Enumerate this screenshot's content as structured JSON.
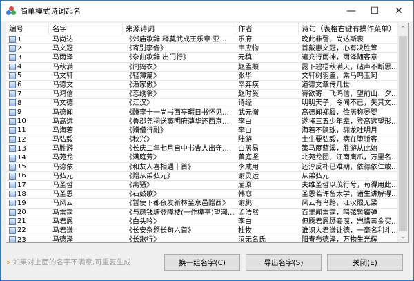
{
  "window": {
    "title": "简单模式诗词起名"
  },
  "table": {
    "headers": [
      "编号",
      "名字",
      "来源诗词",
      "作者",
      "诗句（表格右键有操作菜单）"
    ],
    "rows": [
      [
        "1",
        "马尚达",
        "《郊庙歌辞·释奠武成王乐章·亚…",
        "乐府",
        "晚此非謦，尚达斯衷"
      ],
      [
        "2",
        "马文冠",
        "《寄别李儋》",
        "韦应物",
        "首戴惠文冠，心有决胜筹"
      ],
      [
        "3",
        "马雨泽",
        "《杂曲歌辞·出门行》",
        "元稹",
        "遣充行雨神，雨泽随客意"
      ],
      [
        "4",
        "马秋满",
        "《闻捣衣》",
        "赵孟頫",
        "露下碧梧秋满天，砧声不断思…"
      ],
      [
        "5",
        "马文轩",
        "《轻薄篇》",
        "张华",
        "文轩树羽盖，乘马鸣玉珂"
      ],
      [
        "6",
        "马德文",
        "《渔家傲》",
        "辛弃疾",
        "道德文章传几世"
      ],
      [
        "7",
        "马鸿信",
        "《恋绣衾》",
        "赵时奚",
        "待欲寄、飞鸿信，望前山、夕…"
      ],
      [
        "8",
        "马文德",
        "《江汉》",
        "诗经",
        "明明天子，令闻不已，矢其文…"
      ],
      [
        "9",
        "马德闻",
        "《酬李十一尚书西亭暇日书怀见寄…",
        "武元衡",
        "高德闻郑履，俭居称晏婴"
      ],
      [
        "10",
        "马高远",
        "《鲁郡尧祠送窦明府薄华还西京（…",
        "李白",
        "遂将三五少年辈，登高远望形…"
      ],
      [
        "11",
        "马海若",
        "《赠僧行融》",
        "李白",
        "海若不隐珠，骊龙吐明月"
      ],
      [
        "12",
        "马弘毅",
        "《秋兴》",
        "陆游",
        "士生要弘毅，病在堕骄客"
      ],
      [
        "13",
        "马胜游",
        "《长庆二年七月自中书舍人出守杭…",
        "白居易",
        "策马度蓝溪，胜游从此始"
      ],
      [
        "14",
        "马苑龙",
        "《满庭芳》",
        "黄庭坚",
        "北苑龙团，江南鹰爪，万里名…"
      ],
      [
        "15",
        "马德依",
        "《和友人喜相遇十首》",
        "李咸用",
        "还淳反朴已难期，依德依仁敢…"
      ],
      [
        "16",
        "马弘元",
        "《赠从弟弘元》",
        "谢灵运",
        "从弟弘元"
      ],
      [
        "17",
        "马圣哲",
        "《离骚》",
        "屈原",
        "夫维圣哲以茂行兮，苟得用此…"
      ],
      [
        "18",
        "马圣恩",
        "《石鼓歌》",
        "韩愈",
        "圣恩若许留太学，诸生讲解得…"
      ],
      [
        "19",
        "马风云",
        "《暂使下都夜发新林至京邑赠西》",
        "谢朓",
        "风云有鸟路，江汉限无梁"
      ],
      [
        "20",
        "马雷霆",
        "《与颜钱塘登障楼(一作樟亭)望潮…",
        "孟浩然",
        "百里闻雷霆，鸣弦暂辍弹"
      ],
      [
        "21",
        "马君恩",
        "《白头吟》",
        "李白",
        "但愿君恩顾妾深，岂惜黄金买…"
      ],
      [
        "22",
        "马君谦",
        "《长安杂题长句六首》",
        "杜牧",
        "谁识大君谦让德，一毫名利斗…"
      ],
      [
        "23",
        "马德泽",
        "《长歌行》",
        "汉无名氏",
        "阳春布德泽，万物生光辉"
      ]
    ]
  },
  "footer": {
    "hint": "如果对上面的名字不满意,可重复生成",
    "buttons": {
      "regenerate": "换一组名字(C)",
      "export": "导出名字(S)",
      "close": "关闭(E)"
    }
  }
}
